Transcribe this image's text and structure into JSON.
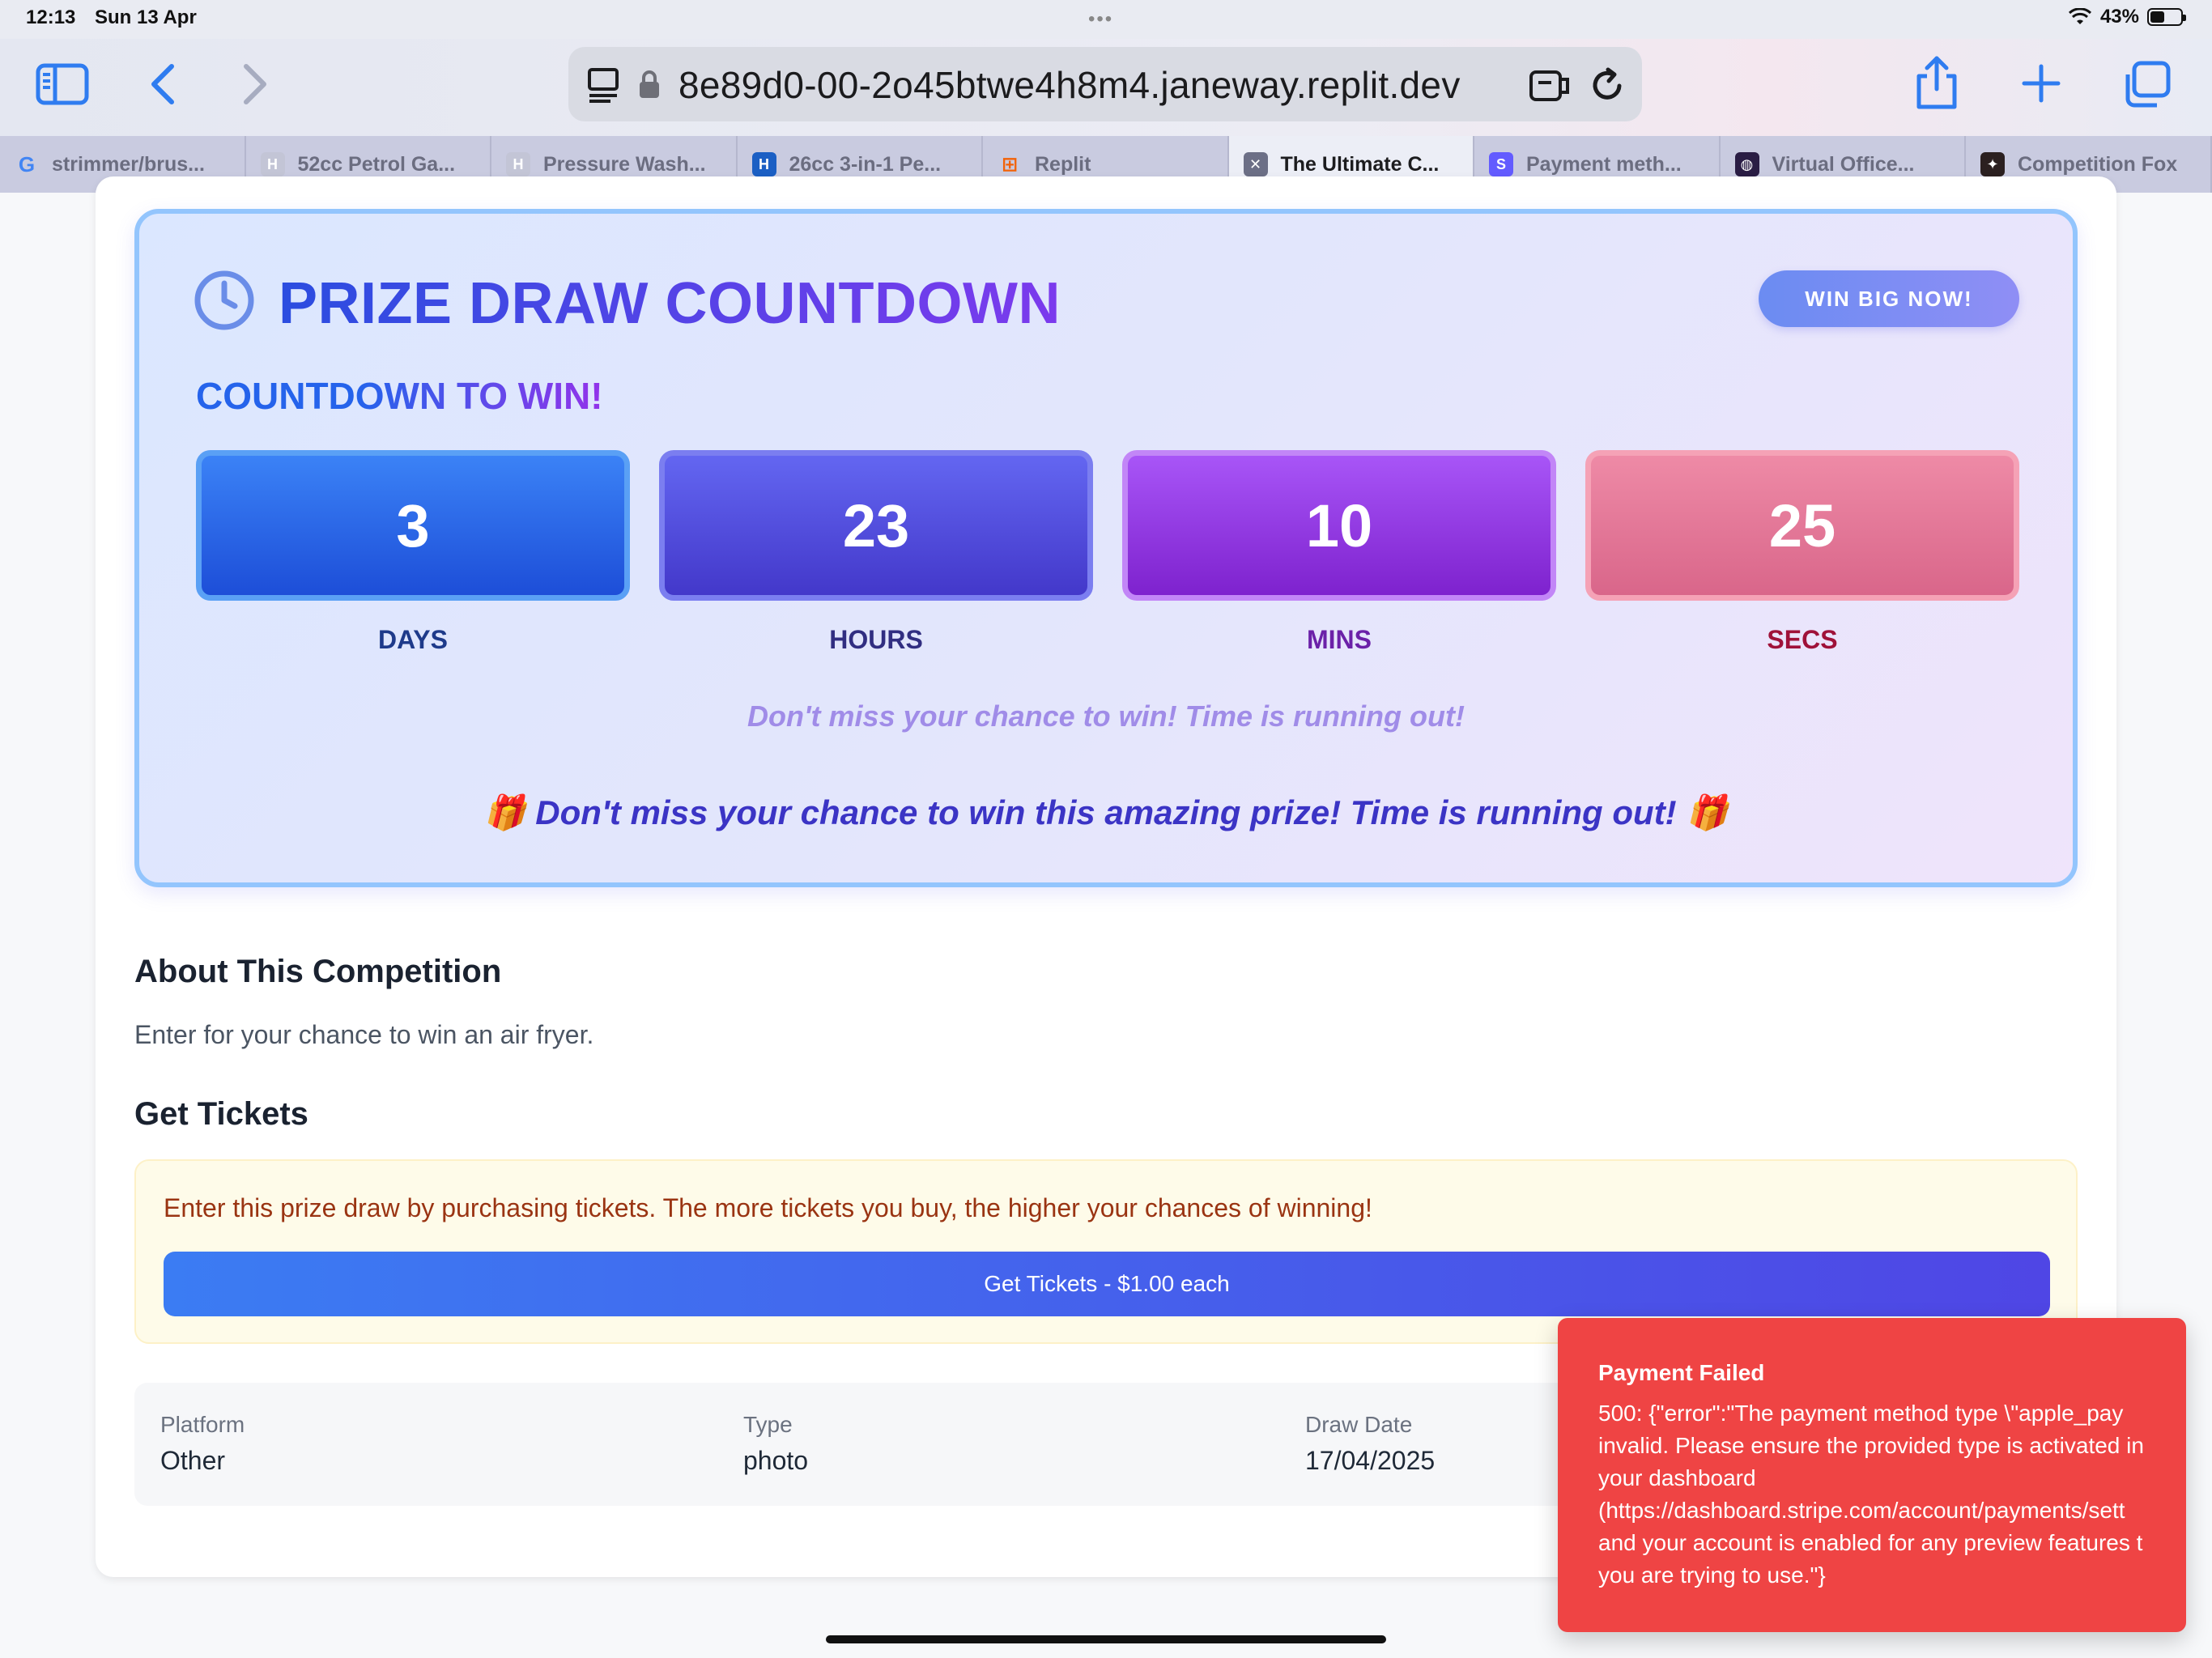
{
  "status_bar": {
    "time": "12:13",
    "date": "Sun 13 Apr",
    "battery": "43%",
    "battery_level": 0.43
  },
  "toolbar": {
    "url": "8e89d0-00-2o45btwe4h8m4.janeway.replit.dev"
  },
  "tabs": [
    {
      "label": "strimmer/brus...",
      "favicon": "google-icon",
      "color": "#ffffff",
      "active": false
    },
    {
      "label": "52cc Petrol Ga...",
      "favicon": "h-icon",
      "color": "#c3c5d6",
      "active": false
    },
    {
      "label": "Pressure Wash...",
      "favicon": "h-icon",
      "color": "#c3c5d6",
      "active": false
    },
    {
      "label": "26cc 3-in-1 Pe...",
      "favicon": "h-icon",
      "color": "#1b5fc4",
      "active": false
    },
    {
      "label": "Replit",
      "favicon": "replit-icon",
      "color": "#f26207",
      "active": false
    },
    {
      "label": "The Ultimate C...",
      "favicon": "x-icon",
      "color": "#6c6f86",
      "active": true
    },
    {
      "label": "Payment meth...",
      "favicon": "stripe-icon",
      "color": "#635bff",
      "active": false
    },
    {
      "label": "Virtual Office...",
      "favicon": "globe-icon",
      "color": "#2a1d44",
      "active": false
    },
    {
      "label": "Competition Fox",
      "favicon": "fox-icon",
      "color": "#2b2020",
      "active": false
    }
  ],
  "countdown": {
    "title": "PRIZE DRAW COUNTDOWN",
    "subtitle": "COUNTDOWN TO WIN!",
    "button": "WIN BIG NOW!",
    "units": [
      {
        "value": "3",
        "label": "DAYS"
      },
      {
        "value": "23",
        "label": "HOURS"
      },
      {
        "value": "10",
        "label": "MINS"
      },
      {
        "value": "25",
        "label": "SECS"
      }
    ],
    "note": "Don't miss your chance to win! Time is running out!",
    "footer": "🎁 Don't miss your chance to win this amazing prize! Time is running out! 🎁"
  },
  "about": {
    "heading": "About This Competition",
    "text": "Enter for your chance to win an air fryer."
  },
  "tickets": {
    "heading": "Get Tickets",
    "text": "Enter this prize draw by purchasing tickets. The more tickets you buy, the higher your chances of winning!",
    "button": "Get Tickets - $1.00 each"
  },
  "info": [
    {
      "label": "Platform",
      "value": "Other"
    },
    {
      "label": "Type",
      "value": "photo"
    },
    {
      "label": "Draw Date",
      "value": "17/04/2025"
    }
  ],
  "toast": {
    "title": "Payment Failed",
    "lines": [
      "500: {\"error\":\"The payment method type \\\"apple_pay",
      "invalid. Please ensure the provided type is activated in",
      "your dashboard",
      "(https://dashboard.stripe.com/account/payments/sett",
      "and your account is enabled for any preview features t",
      "you are trying to use.\"}"
    ]
  }
}
